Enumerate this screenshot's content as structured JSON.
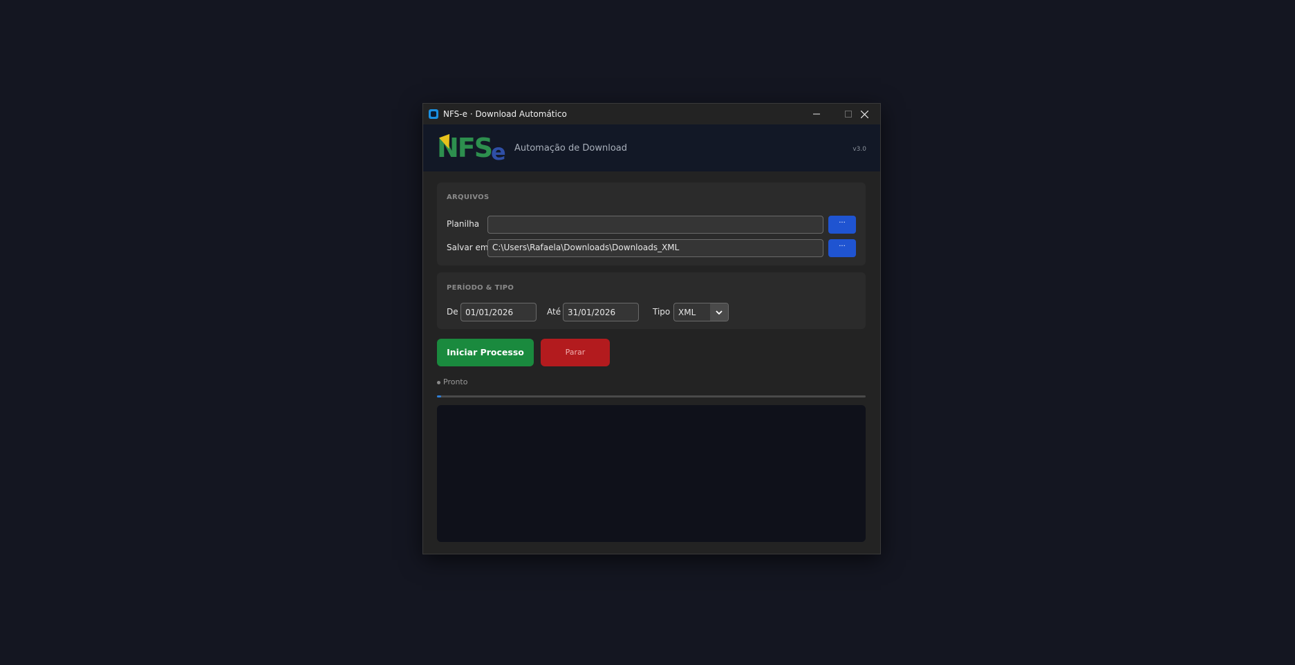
{
  "window": {
    "title": "NFS-e · Download Automático",
    "controls": {
      "minimize_icon": "minimize-icon",
      "maximize_icon": "maximize-icon",
      "close_icon": "close-icon"
    }
  },
  "header": {
    "logo_text": "NFS",
    "logo_suffix": "e",
    "subtitle": "Automação de Download",
    "version": "v3.0"
  },
  "files_section": {
    "title": "ARQUIVOS",
    "spreadsheet_label": "Planilha",
    "spreadsheet_value": "",
    "save_label": "Salvar em",
    "save_value": "C:\\Users\\Rafaela\\Downloads\\Downloads_XML",
    "browse_label": "···"
  },
  "period_section": {
    "title": "PERÍODO  &  TIPO",
    "from_label": "De",
    "from_value": "01/01/2026",
    "to_label": "Até",
    "to_value": "31/01/2026",
    "type_label": "Tipo",
    "type_value": "XML"
  },
  "actions": {
    "start_label": "Iniciar Processo",
    "stop_label": "Parar"
  },
  "status": {
    "text": "Pronto",
    "progress": 0.01
  },
  "colors": {
    "accent_blue": "#1f54d1",
    "start_green": "#1a8a3e",
    "stop_red": "#b31b1e",
    "background": "#141621"
  }
}
